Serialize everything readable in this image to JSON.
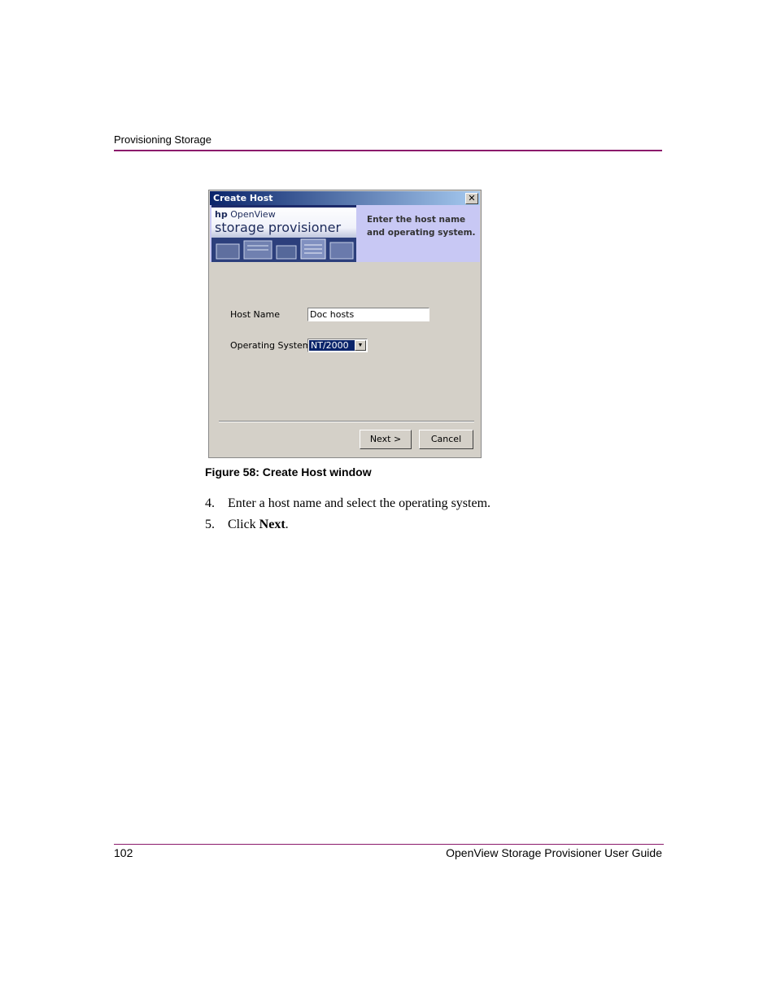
{
  "page": {
    "running_header": "Provisioning Storage",
    "page_number": "102",
    "footer_title": "OpenView Storage Provisioner User Guide"
  },
  "dialog": {
    "title": "Create Host",
    "close_glyph": "✕",
    "banner": {
      "logo_brand": "hp",
      "logo_product": " OpenView",
      "logo_subtitle": "storage provisioner",
      "instruction": "Enter the host name\nand operating system."
    },
    "fields": {
      "host_name_label": "Host Name",
      "host_name_value": "Doc hosts",
      "os_label": "Operating System",
      "os_value": "NT/2000"
    },
    "buttons": {
      "next": "Next >",
      "cancel": "Cancel"
    }
  },
  "figure": {
    "caption": "Figure 58:  Create Host window"
  },
  "steps": [
    {
      "number": "4.",
      "text": "Enter a host name and select the operating system."
    },
    {
      "number": "5.",
      "prefix": "Click ",
      "bold": "Next",
      "suffix": "."
    }
  ],
  "colors": {
    "accent_rule": "#8b1a6b",
    "titlebar_start": "#0a246a",
    "titlebar_end": "#a6caf0",
    "banner_bg": "#c8c8f4",
    "dialog_bg": "#d4d0c8"
  }
}
